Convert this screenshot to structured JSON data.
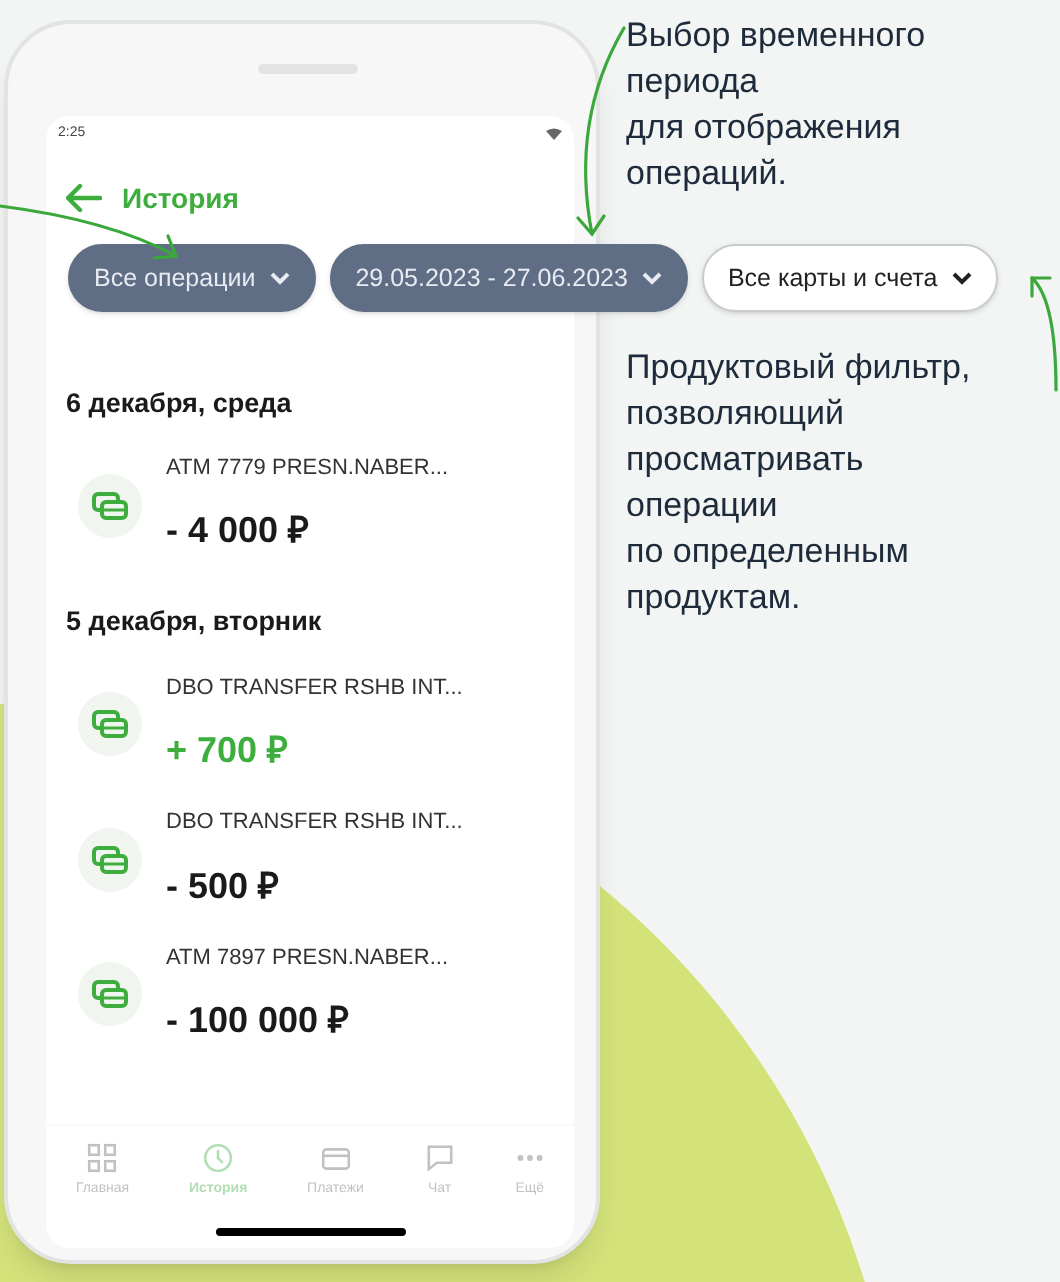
{
  "status_bar": {
    "time": "2:25"
  },
  "header": {
    "title": "История"
  },
  "filters": [
    {
      "label": "Все операции",
      "kind": "dark"
    },
    {
      "label": "29.05.2023 - 27.06.2023",
      "kind": "dark"
    },
    {
      "label": "Все карты и счета",
      "kind": "light"
    }
  ],
  "sections": [
    {
      "date": "6 декабря, среда",
      "transactions": [
        {
          "title": "ATM 7779 PRESN.NABER...",
          "amount": "- 4 000 ₽",
          "kind": "expense"
        }
      ]
    },
    {
      "date": "5 декабря, вторник",
      "transactions": [
        {
          "title": "DBO TRANSFER RSHB INT...",
          "amount": "+ 700 ₽",
          "kind": "income"
        },
        {
          "title": "DBO TRANSFER RSHB INT...",
          "amount": "- 500 ₽",
          "kind": "expense"
        },
        {
          "title": "ATM 7897 PRESN.NABER...",
          "amount": "- 100 000 ₽",
          "kind": "expense"
        }
      ]
    }
  ],
  "bottom_nav": [
    {
      "label": "Главная",
      "kind": "grid",
      "selected": false
    },
    {
      "label": "История",
      "kind": "clock",
      "selected": true
    },
    {
      "label": "Платежи",
      "kind": "card",
      "selected": false
    },
    {
      "label": "Чат",
      "kind": "chat",
      "selected": false
    },
    {
      "label": "Ещё",
      "kind": "dots",
      "selected": false
    }
  ],
  "annotations": [
    {
      "text": "Выбор временного\nпериода\nдля отображения\nопераций."
    },
    {
      "text": "Продуктовый фильтр,\nпозволяющий\nпросматривать\nоперации\nпо определенным\nпродуктам."
    }
  ]
}
